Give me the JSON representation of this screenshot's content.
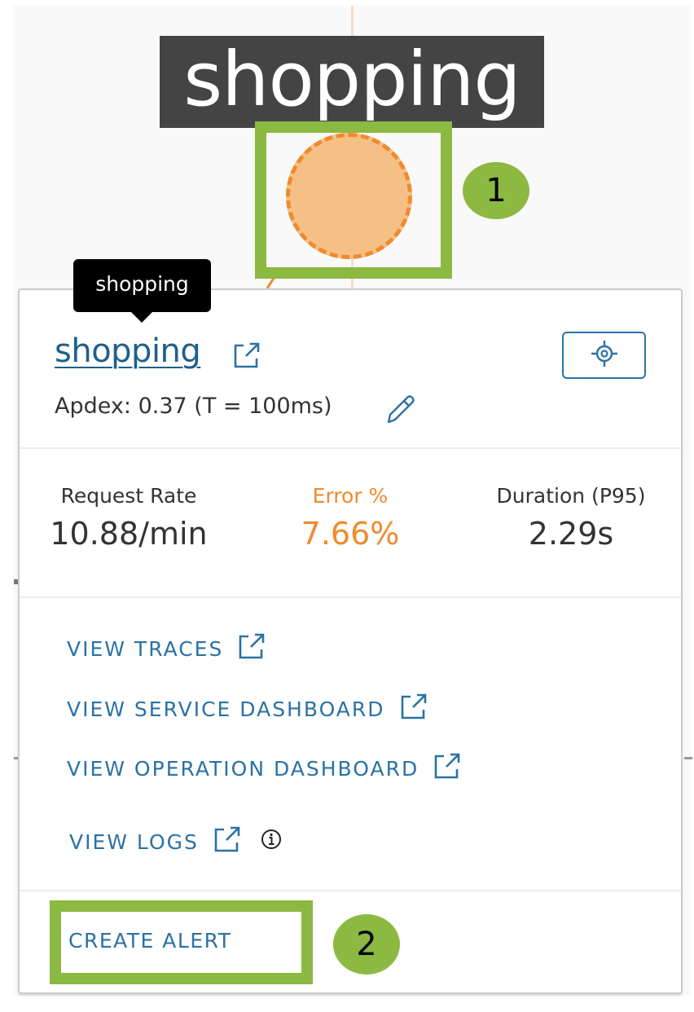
{
  "graph": {
    "node_label": "shopping",
    "node_color": "#f4c086",
    "node_stroke": "#f08a2c"
  },
  "annotations": {
    "highlight_color": "#8bb942",
    "callouts": [
      {
        "number": "1",
        "target": "service-node"
      },
      {
        "number": "2",
        "target": "create-alert"
      }
    ]
  },
  "tooltip": {
    "text": "shopping"
  },
  "card": {
    "service_name": "shopping",
    "service_link_icon": "external-link-icon",
    "apdex_label": "Apdex:",
    "apdex_value": "0.37",
    "apdex_threshold": "(T = 100ms)",
    "edit_icon": "pencil-icon",
    "locate_icon": "crosshair-icon",
    "metrics": [
      {
        "label": "Request Rate",
        "value": "10.88/min"
      },
      {
        "label": "Error %",
        "value": "7.66%"
      },
      {
        "label": "Duration (P95)",
        "value": "2.29s"
      }
    ],
    "error_color": "#f08a2c",
    "link_color": "#2a72a5",
    "actions": [
      {
        "label": "VIEW TRACES",
        "icon": "external-link-icon"
      },
      {
        "label": "VIEW SERVICE DASHBOARD",
        "icon": "external-link-icon"
      },
      {
        "label": "VIEW OPERATION DASHBOARD",
        "icon": "external-link-icon"
      },
      {
        "label": "VIEW LOGS",
        "icon": "external-link-icon",
        "extra_icon": "info-icon"
      }
    ],
    "create_alert_label": "CREATE ALERT"
  }
}
